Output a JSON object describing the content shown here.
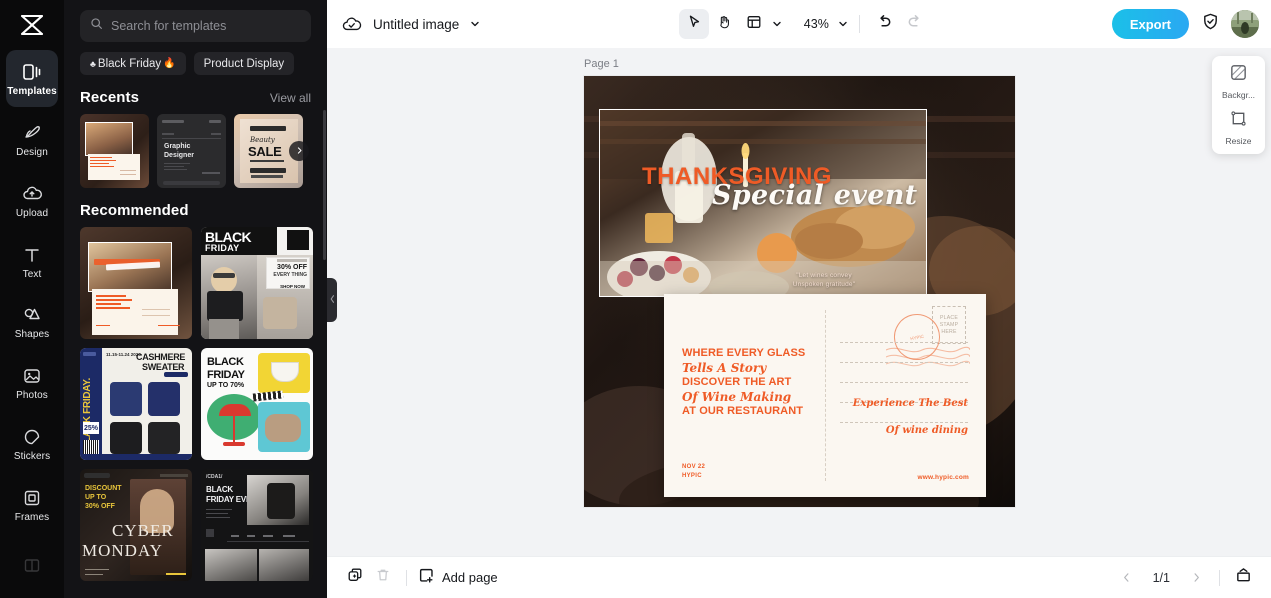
{
  "app": {
    "name": "Hypic Design Editor",
    "accent": "#1bc0e8",
    "panel_bg": "#131316",
    "rail_bg": "#0a0a0b",
    "canvas_bg": "#f2f3f5",
    "brand_orange": "#ef5b26"
  },
  "rail": {
    "logo_icon": "hypic-logo-icon",
    "items": [
      {
        "label": "Templates",
        "icon": "templates-icon",
        "active": true
      },
      {
        "label": "Design",
        "icon": "design-icon",
        "active": false
      },
      {
        "label": "Upload",
        "icon": "upload-cloud-icon",
        "active": false
      },
      {
        "label": "Text",
        "icon": "text-icon",
        "active": false
      },
      {
        "label": "Shapes",
        "icon": "shapes-icon",
        "active": false
      },
      {
        "label": "Photos",
        "icon": "photos-icon",
        "active": false
      },
      {
        "label": "Stickers",
        "icon": "stickers-icon",
        "active": false
      },
      {
        "label": "Frames",
        "icon": "frames-icon",
        "active": false
      },
      {
        "label": "",
        "icon": "layout-icon",
        "active": false
      }
    ]
  },
  "panel": {
    "search": {
      "placeholder": "Search for templates",
      "icon": "search-icon",
      "value": ""
    },
    "chips": [
      {
        "label": "Black Friday",
        "emoji": "🔥",
        "leading": "♣"
      },
      {
        "label": "Product Display",
        "emoji": "",
        "leading": ""
      }
    ],
    "recents": {
      "title": "Recents",
      "view_all": "View all",
      "next_icon": "chevron-right-icon",
      "items": [
        {
          "name": "thanksgiving-postcard-template"
        },
        {
          "name": "graphic-designer-dark-template",
          "text1": "Graphic",
          "text2": "Designer"
        },
        {
          "name": "beauty-sale-template",
          "text1": "Beauty",
          "text2": "SALE"
        }
      ]
    },
    "recommended": {
      "title": "Recommended",
      "items": [
        {
          "name": "thanksgiving-special-event-template"
        },
        {
          "name": "black-friday-fashion-template",
          "text1": "BLACK",
          "text2": "FRIDAY",
          "badge": "30% OFF",
          "badge2": "EVERY THING",
          "cta": "SHOP NOW"
        },
        {
          "name": "cashmere-sweater-template",
          "text1": "CASHMERE",
          "text2": "SWEATER",
          "side": "BLACK FRIDAY.",
          "date": "11.15-11.24 2024",
          "pct": "25%"
        },
        {
          "name": "black-friday-furniture-template",
          "text1": "BLACK",
          "text2": "FRIDAY",
          "text3": "UP TO 70%"
        },
        {
          "name": "cyber-monday-template",
          "text1": "CYBER",
          "text2": "MONDAY",
          "promo1": "DISCOUNT",
          "promo2": "UP TO",
          "promo3": "30% OFF"
        },
        {
          "name": "black-friday-event-template",
          "text1": "BLACK",
          "text2": "FRIDAY EVENT",
          "brand": "/CDA1/"
        }
      ]
    },
    "collapse_icon": "chevron-left-icon"
  },
  "topbar": {
    "cloud_icon": "cloud-saved-icon",
    "title": "Untitled image",
    "title_caret_icon": "chevron-down-icon",
    "tools": [
      {
        "name": "select-tool",
        "icon": "cursor-arrow-icon",
        "selected": true
      },
      {
        "name": "hand-tool",
        "icon": "hand-icon",
        "selected": false
      },
      {
        "name": "layout-tool",
        "icon": "layout-grid-icon",
        "selected": false
      }
    ],
    "layout_caret_icon": "chevron-down-icon",
    "zoom_value": "43%",
    "zoom_caret_icon": "chevron-down-icon",
    "undo_icon": "undo-icon",
    "redo_icon": "redo-icon",
    "export_label": "Export",
    "shield_icon": "shield-check-icon",
    "avatar_name": "user-avatar"
  },
  "canvas": {
    "page_label": "Page 1",
    "artwork": {
      "hero_title": "THANKSGIVING",
      "hero_script": "Special event",
      "hero_quote": "\"Let wines convey\nUnspoken gratitude\"",
      "postcard": {
        "line1": "WHERE EVERY GLASS",
        "line2": "Tells A Story",
        "line3": "DISCOVER THE ART",
        "line4": "Of Wine Making",
        "line5": "AT OUR RESTAURANT",
        "date": "NOV 22",
        "brand": "HYPIC",
        "url": "www.hypic.com",
        "stamp": "PLACE STAMP HERE",
        "postmark": "HYPIC",
        "sig1": "Experience The Best",
        "sig2": "Of wine dining"
      }
    },
    "right_card": [
      {
        "label": "Backgr...",
        "icon": "background-icon"
      },
      {
        "label": "Resize",
        "icon": "resize-icon"
      }
    ]
  },
  "bottombar": {
    "duplicate_icon": "duplicate-page-icon",
    "delete_icon": "trash-icon",
    "add_page_icon": "add-page-icon",
    "add_page_label": "Add page",
    "prev_icon": "chevron-left-icon",
    "page_indicator": "1/1",
    "next_icon": "chevron-right-icon",
    "notes_icon": "presentation-notes-icon"
  }
}
